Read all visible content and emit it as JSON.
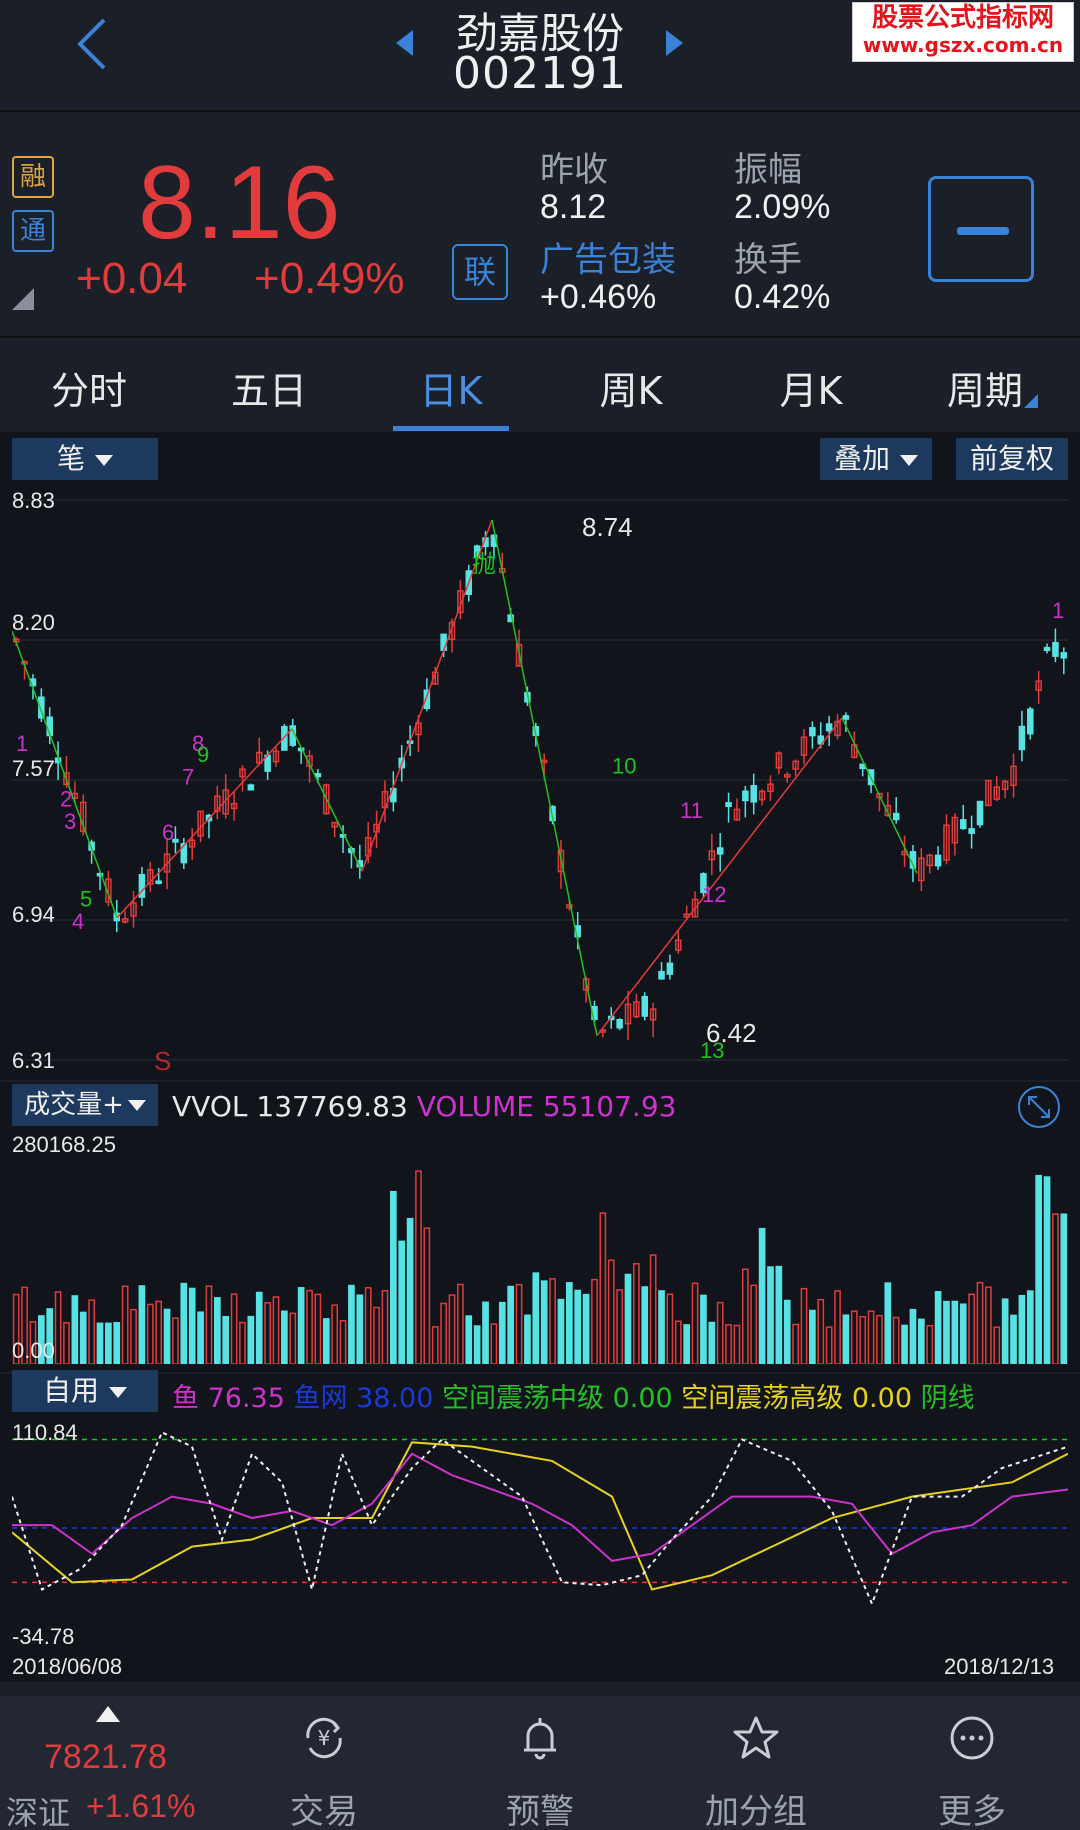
{
  "header": {
    "stock_name": "劲嘉股份",
    "stock_code": "002191",
    "watermark_title": "股票公式指标网",
    "watermark_url": "www.gszx.com.cn"
  },
  "quote": {
    "tag_margin": "融",
    "tag_connect": "通",
    "price": "8.16",
    "change": "+0.04",
    "change_pct": "+0.49%",
    "lian_label": "联",
    "prev_close_label": "昨收",
    "prev_close": "8.12",
    "amplitude_label": "振幅",
    "amplitude": "2.09%",
    "sector_label": "广告包装",
    "sector_change": "+0.46%",
    "turnover_label": "换手",
    "turnover": "0.42%"
  },
  "tabs": [
    {
      "label": "分时"
    },
    {
      "label": "五日"
    },
    {
      "label": "日K"
    },
    {
      "label": "周K"
    },
    {
      "label": "月K"
    },
    {
      "label": "周期"
    }
  ],
  "kline_panel": {
    "mode_button": "笔",
    "overlay_button": "叠加",
    "adjust_button": "前复权",
    "y_labels": [
      "8.83",
      "8.20",
      "7.57",
      "6.94",
      "6.31"
    ],
    "peak_label": "8.74",
    "trough_label": "6.42",
    "throw_marker": "抛",
    "sell_marker": "S",
    "td_counts": [
      "1",
      "2",
      "3",
      "4",
      "5",
      "6",
      "7",
      "8",
      "9",
      "10",
      "11",
      "12",
      "13"
    ]
  },
  "volume_panel": {
    "selector": "成交量+",
    "vvol_label": "VVOL",
    "vvol_value": "137769.83",
    "volume_label": "VOLUME",
    "volume_value": "55107.93",
    "max_label": "280168.25",
    "min_label": "0.00"
  },
  "indicator_panel": {
    "selector": "自用",
    "fish_label": "鱼",
    "fish_value": "76.35",
    "fishnet_label": "鱼网",
    "fishnet_value": "38.00",
    "mid_label": "空间震荡中级",
    "mid_value": "0.00",
    "high_label": "空间震荡高级",
    "high_value": "0.00",
    "yin_label": "阴线",
    "max_label": "110.84",
    "min_label": "-34.78",
    "start_date": "2018/06/08",
    "end_date": "2018/12/13"
  },
  "bottom_nav": {
    "index_value": "7821.78",
    "index_name": "深证",
    "index_change": "+1.61%",
    "items": [
      {
        "label": "交易",
        "icon": "trade-yen-icon"
      },
      {
        "label": "预警",
        "icon": "bell-icon"
      },
      {
        "label": "加分组",
        "icon": "star-icon"
      },
      {
        "label": "更多",
        "icon": "more-dots-icon"
      }
    ]
  },
  "colors": {
    "up": "#e23b3b",
    "down": "#57e3e3",
    "accent": "#3b82d6",
    "fish": "#cc33cc",
    "fishnet": "#1a3ad8",
    "mid": "#22c022",
    "high": "#e6d21e"
  }
}
